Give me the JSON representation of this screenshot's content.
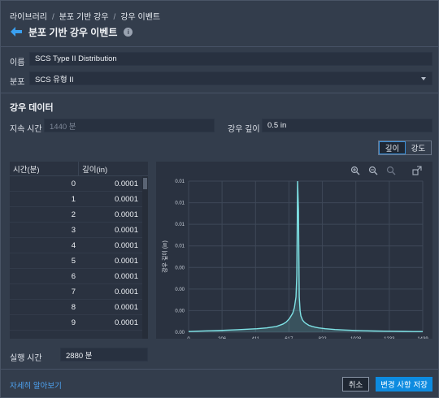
{
  "breadcrumb": [
    "라이브러리",
    "분포 기반 강우",
    "강우 이벤트"
  ],
  "page_title": "분포 기반 강우 이벤트",
  "info_icon": "i",
  "form": {
    "name_label": "이름",
    "name_value": "SCS Type II Distribution",
    "dist_label": "분포",
    "dist_value": "SCS 유형 II"
  },
  "rain": {
    "section": "강우 데이터",
    "duration_label": "지속 시간",
    "duration_value": "1440 분",
    "depth_label": "강우 깊이",
    "depth_value": "0.5 in",
    "tab_depth": "깊이",
    "tab_intensity": "강도"
  },
  "table": {
    "headers": [
      "시간(분)",
      "깊이(in)"
    ],
    "rows": [
      [
        "0",
        "0.0001"
      ],
      [
        "1",
        "0.0001"
      ],
      [
        "2",
        "0.0001"
      ],
      [
        "3",
        "0.0001"
      ],
      [
        "4",
        "0.0001"
      ],
      [
        "5",
        "0.0001"
      ],
      [
        "6",
        "0.0001"
      ],
      [
        "7",
        "0.0001"
      ],
      [
        "8",
        "0.0001"
      ],
      [
        "9",
        "0.0001"
      ]
    ]
  },
  "run_time": {
    "label": "실행 시간",
    "value": "2880 분"
  },
  "footer": {
    "link": "자세히 알아보기",
    "cancel": "취소",
    "save": "변경 사항 저장"
  },
  "colors": {
    "accent": "#0d8be0",
    "series": "#7fe3e6"
  },
  "chart_data": {
    "type": "area",
    "xlabel": "시간 (분)",
    "ylabel": "강우 깊이 (in)",
    "x_ticks": [
      "0",
      "206",
      "411",
      "617",
      "822",
      "1028",
      "1233",
      "1439"
    ],
    "y_ticks": [
      "0.00",
      "0.00",
      "0.00",
      "0.00",
      "0.01",
      "0.01",
      "0.01",
      "0.01"
    ],
    "xlim": [
      0,
      1439
    ],
    "ylim": [
      0,
      0.0111
    ],
    "grid": true,
    "series": [
      {
        "x": [
          0,
          60,
          120,
          180,
          240,
          300,
          360,
          420,
          480,
          540,
          580,
          600,
          620,
          640,
          650,
          660,
          665,
          670,
          675,
          680,
          685,
          690,
          700,
          710,
          720,
          740,
          760,
          780,
          800,
          840,
          900,
          960,
          1020,
          1080,
          1140,
          1200,
          1260,
          1320,
          1380,
          1439
        ],
        "values": [
          5e-05,
          8e-05,
          0.0001,
          0.00012,
          0.00015,
          0.00018,
          0.00022,
          0.00026,
          0.00032,
          0.00042,
          0.0006,
          0.00075,
          0.001,
          0.0014,
          0.0018,
          0.0026,
          0.0042,
          0.0111,
          0.009,
          0.0026,
          0.0016,
          0.0012,
          0.0009,
          0.00075,
          0.00065,
          0.0005,
          0.00042,
          0.00036,
          0.00032,
          0.00026,
          0.0002,
          0.00016,
          0.00013,
          0.00011,
          9e-05,
          8e-05,
          7e-05,
          6e-05,
          5e-05,
          5e-05
        ]
      }
    ]
  }
}
